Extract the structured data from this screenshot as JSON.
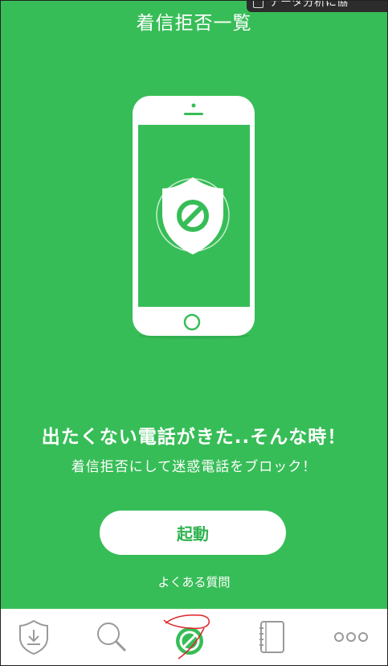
{
  "header": {
    "title": "着信拒否一覧"
  },
  "overlay": {
    "label": "データ分析に協"
  },
  "hero": {
    "headline": "出たくない電話がきた..そんな時！",
    "subline": "着信拒否にして迷惑電話をブロック！"
  },
  "actions": {
    "start_label": "起動",
    "faq_label": "よくある質問"
  },
  "tabs": [
    {
      "icon": "download-shield-icon"
    },
    {
      "icon": "search-icon"
    },
    {
      "icon": "block-shield-icon",
      "active": true
    },
    {
      "icon": "notebook-icon"
    },
    {
      "icon": "more-dots-icon"
    }
  ],
  "colors": {
    "background": "#37bd57",
    "accent_text": "#2fb34f",
    "tab_icon": "#9a9a9a",
    "annotation": "#e0232a"
  }
}
